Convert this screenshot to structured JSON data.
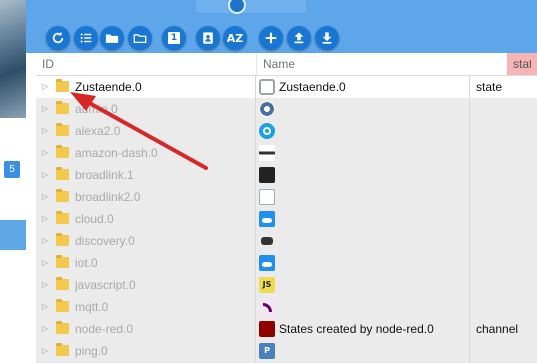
{
  "sidebar": {
    "badge": "5"
  },
  "toolbar": {
    "buttons": [
      {
        "name": "refresh-button",
        "icon": "refresh-icon"
      },
      {
        "name": "list-view-button",
        "icon": "list-icon"
      },
      {
        "name": "folder-filled-button",
        "icon": "folder-icon"
      },
      {
        "name": "folder-outline-button",
        "icon": "folder-outline-icon"
      },
      {
        "name": "number-one-button",
        "icon": "one-icon",
        "label": "1"
      },
      {
        "name": "contacts-button",
        "icon": "contact-icon"
      },
      {
        "name": "sort-az-button",
        "icon": "sort-az-icon",
        "label": "AZ"
      },
      {
        "name": "add-button",
        "icon": "plus-icon"
      },
      {
        "name": "upload-button",
        "icon": "upload-icon"
      },
      {
        "name": "download-button",
        "icon": "download-icon"
      }
    ]
  },
  "filters": {
    "id_placeholder": "ID",
    "name_placeholder": "Name",
    "type_value": "stat"
  },
  "rows": [
    {
      "id": "Zustaende.0",
      "name": "Zustaende.0",
      "type": "state",
      "icon": "settings-circle-icon",
      "icon_color": "#9aa3ab",
      "dim": false
    },
    {
      "id": "admin.0",
      "name": "",
      "type": "",
      "icon": "gear-icon",
      "icon_color": "#4a6fa5",
      "dim": true
    },
    {
      "id": "alexa2.0",
      "name": "",
      "type": "",
      "icon": "alexa-icon",
      "icon_color": "#1aa1e4",
      "dim": true
    },
    {
      "id": "amazon-dash.0",
      "name": "",
      "type": "",
      "icon": "dash-button-icon",
      "icon_color": "#333333",
      "dim": true
    },
    {
      "id": "broadlink.1",
      "name": "",
      "type": "",
      "icon": "broadlink-icon",
      "icon_color": "#222222",
      "dim": true
    },
    {
      "id": "broadlink2.0",
      "name": "",
      "type": "",
      "icon": "broadlink2-icon",
      "icon_color": "#3b7bbf",
      "dim": true
    },
    {
      "id": "cloud.0",
      "name": "",
      "type": "",
      "icon": "cloud-icon",
      "icon_color": "#1f8ff0",
      "dim": true
    },
    {
      "id": "discovery.0",
      "name": "",
      "type": "",
      "icon": "binoculars-icon",
      "icon_color": "#333333",
      "dim": true
    },
    {
      "id": "iot.0",
      "name": "",
      "type": "",
      "icon": "cloud-icon",
      "icon_color": "#1f8ff0",
      "dim": true
    },
    {
      "id": "javascript.0",
      "name": "",
      "type": "",
      "icon": "js-icon",
      "icon_color": "#f0db4f",
      "dim": true
    },
    {
      "id": "mqtt.0",
      "name": "",
      "type": "",
      "icon": "mqtt-icon",
      "icon_color": "#660066",
      "dim": true
    },
    {
      "id": "node-red.0",
      "name": "States created by node-red.0",
      "type": "channel",
      "icon": "node-red-icon",
      "icon_color": "#8f0000",
      "dim": true
    },
    {
      "id": "ping.0",
      "name": "",
      "type": "",
      "icon": "ping-icon",
      "icon_color": "#4a7fc0",
      "dim": true
    }
  ],
  "colors": {
    "toolbar": "#5ea6ea",
    "button": "#1976d2",
    "type_filter": "#f7b4b4",
    "arrow": "#d62828"
  }
}
